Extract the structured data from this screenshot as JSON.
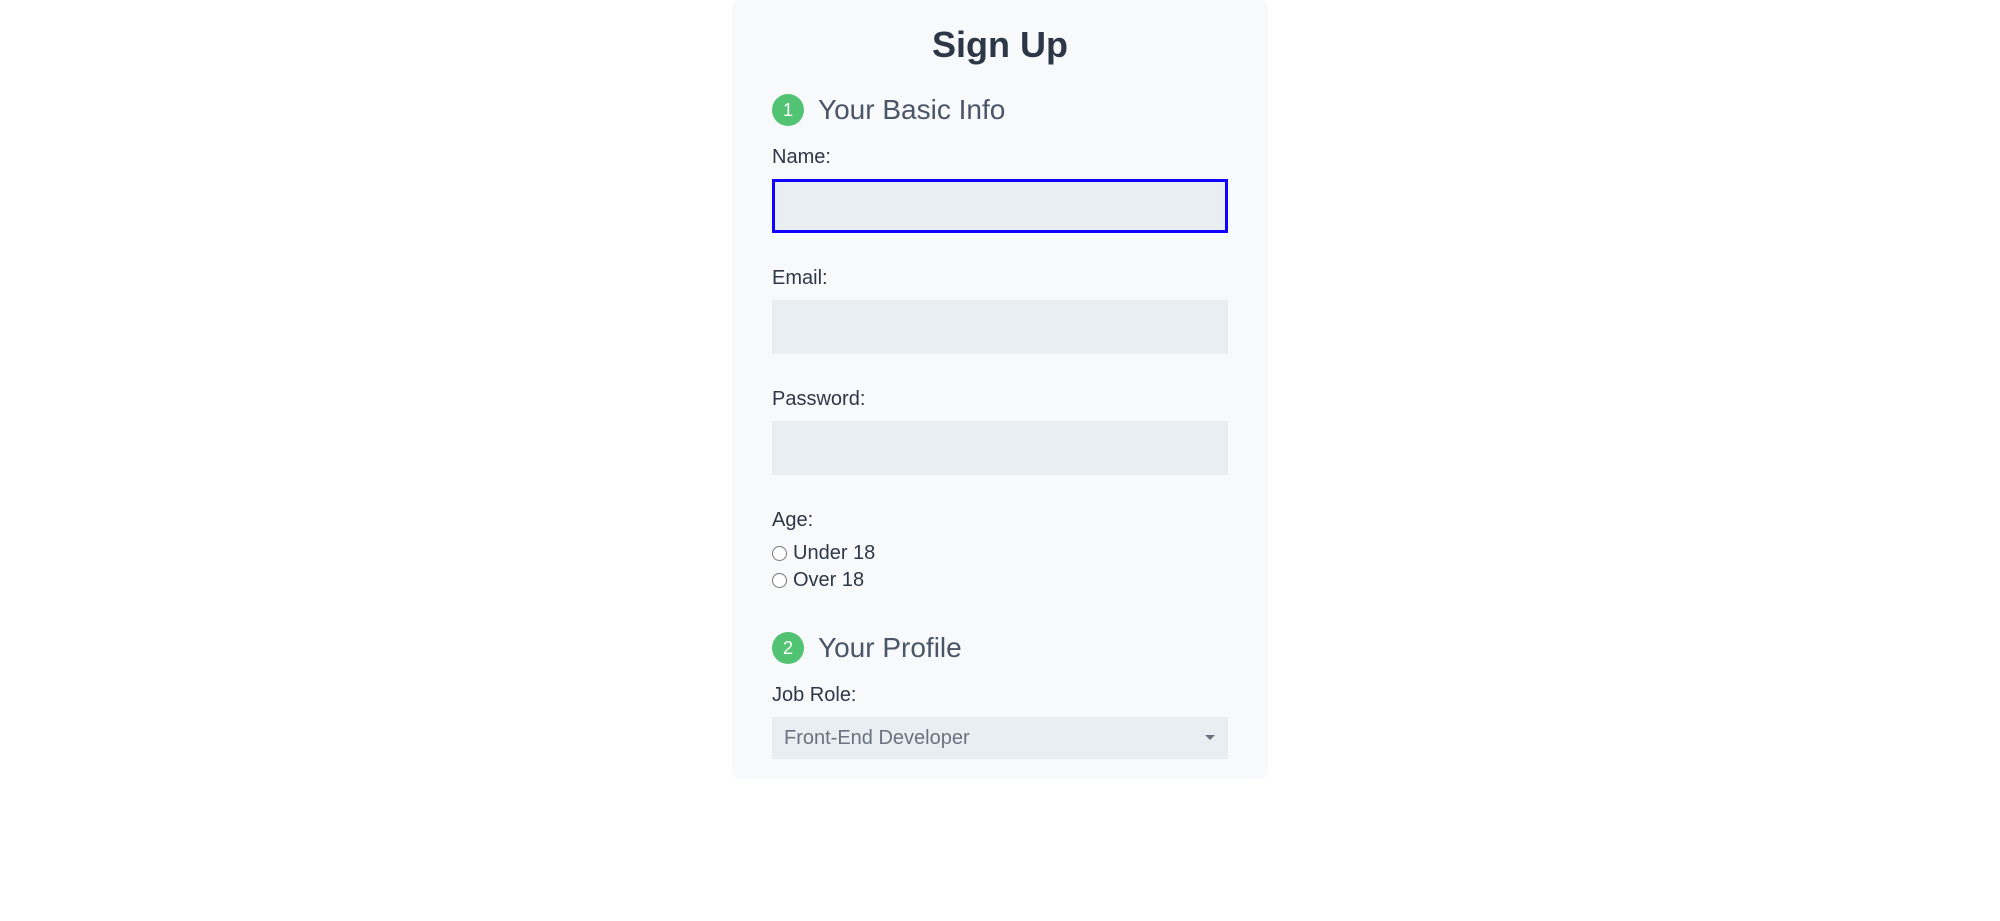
{
  "page": {
    "title": "Sign Up"
  },
  "section1": {
    "badge": "1",
    "title": "Your Basic Info",
    "nameLabel": "Name:",
    "emailLabel": "Email:",
    "passwordLabel": "Password:",
    "ageLabel": "Age:",
    "ageOptions": {
      "under18": "Under 18",
      "over18": "Over 18"
    }
  },
  "section2": {
    "badge": "2",
    "title": "Your Profile",
    "jobRoleLabel": "Job Role:",
    "jobRoleSelected": "Front-End Developer"
  }
}
